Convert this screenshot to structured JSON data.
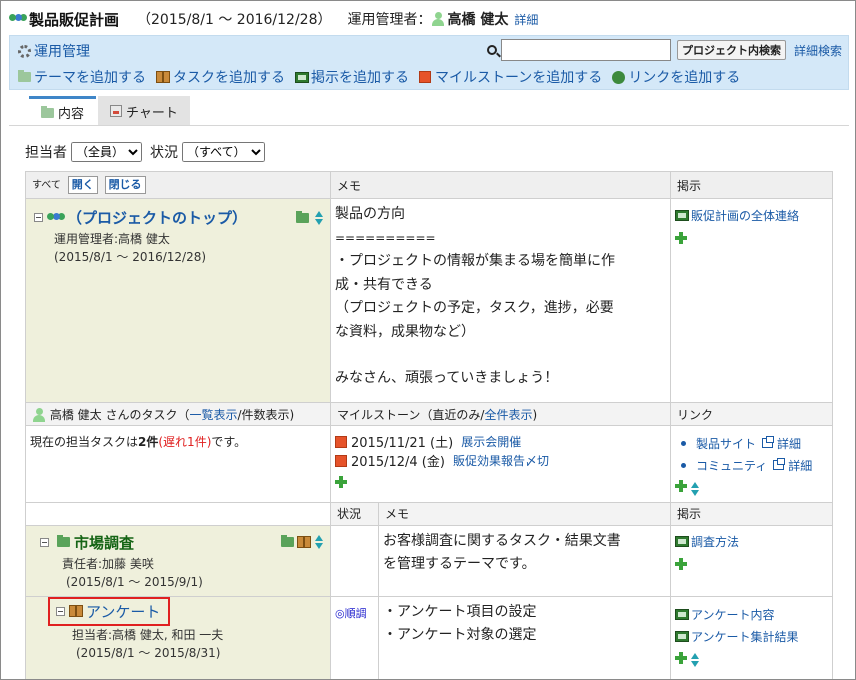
{
  "header": {
    "title": "製品販促計画",
    "period": "（2015/8/1 ～ 2016/12/28）",
    "manager_label": "運用管理者：",
    "manager_name": "高橋 健太",
    "detail_link": "詳細"
  },
  "toolbar": {
    "manage_label": "運用管理",
    "search_placeholder": "",
    "search_button": "プロジェクト内検索",
    "advanced_search": "詳細検索",
    "actions": {
      "add_theme": "テーマを追加する",
      "add_task": "タスクを追加する",
      "add_notice": "掲示を追加する",
      "add_milestone": "マイルストーンを追加する",
      "add_link": "リンクを追加する"
    }
  },
  "tabs": {
    "content": "内容",
    "chart": "チャート"
  },
  "filter": {
    "assignee_label": "担当者",
    "assignee_value": "（全員）",
    "status_label": "状況",
    "status_value": "（すべて）"
  },
  "grid": {
    "header": {
      "all_label": "すべて",
      "open_button": "開く",
      "close_button": "閉じる",
      "memo": "メモ",
      "notice": "掲示"
    },
    "project": {
      "name": "（プロジェクトのトップ）",
      "manager": "運用管理者:高橋 健太",
      "period": "(2015/8/1 ～ 2016/12/28)",
      "memo_lines": [
        "製品の方向",
        "==========",
        "・プロジェクトの情報が集まる場を簡単に作",
        "成・共有できる",
        "（プロジェクトの予定，タスク，進捗，必要",
        "な資料，成果物など）",
        "",
        "みなさん、頑張っていきましょう！"
      ],
      "notice": "販促計画の全体連絡"
    },
    "task_section": {
      "user_task": "高橋 健太 さんのタスク（",
      "list_view": "一覧表示",
      "count_view": "/件数表示)",
      "milestone_label": "マイルストーン（直近のみ/",
      "show_all": "全件表示",
      "milestone_close": ")",
      "link_label": "リンク",
      "current_prefix": "現在の担当タスクは",
      "current_count": "2件",
      "current_late": "(遅れ1件)",
      "current_suffix": "です。",
      "milestones": [
        {
          "date": "2015/11/21 (土)",
          "name": "展示会開催"
        },
        {
          "date": "2015/12/4 (金)",
          "name": "販促効果報告〆切"
        }
      ],
      "links": [
        {
          "name": "製品サイト",
          "detail": "詳細"
        },
        {
          "name": "コミュニティ",
          "detail": "詳細"
        }
      ]
    },
    "sub_header": {
      "status": "状況",
      "memo": "メモ",
      "notice": "掲示"
    },
    "theme": {
      "name": "市場調査",
      "owner": "責任者:加藤 美咲",
      "period": "(2015/8/1 ～ 2015/9/1)",
      "memo_lines": [
        "お客様調査に関するタスク・結果文書",
        "を管理するテーマです。"
      ],
      "notice": "調査方法"
    },
    "task": {
      "name": "アンケート",
      "assignee": "担当者:高橋 健太, 和田 一夫",
      "period": "(2015/8/1 ～ 2015/8/31)",
      "status": "◎順調",
      "memo_lines": [
        "・アンケート項目の設定",
        "・アンケート対象の選定"
      ],
      "notices": [
        "アンケート内容",
        "アンケート集計結果"
      ]
    }
  }
}
